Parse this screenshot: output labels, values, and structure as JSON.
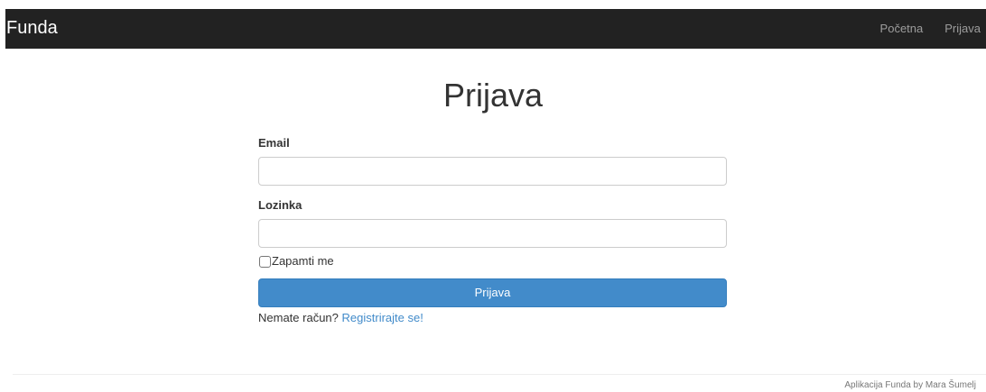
{
  "navbar": {
    "brand": "Funda",
    "links": [
      "Početna",
      "Prijava"
    ]
  },
  "page": {
    "title": "Prijava"
  },
  "form": {
    "email_label": "Email",
    "email_value": "",
    "password_label": "Lozinka",
    "password_value": "",
    "remember_label": "Zapamti me",
    "remember_checked": false,
    "submit_label": "Prijava",
    "register_prompt": "Nemate račun?",
    "register_link": "Registrirajte se!"
  },
  "footer": {
    "text": "Aplikacija Funda by Mara Šumelj"
  },
  "colors": {
    "navbar_bg": "#222222",
    "primary": "#428bca"
  }
}
